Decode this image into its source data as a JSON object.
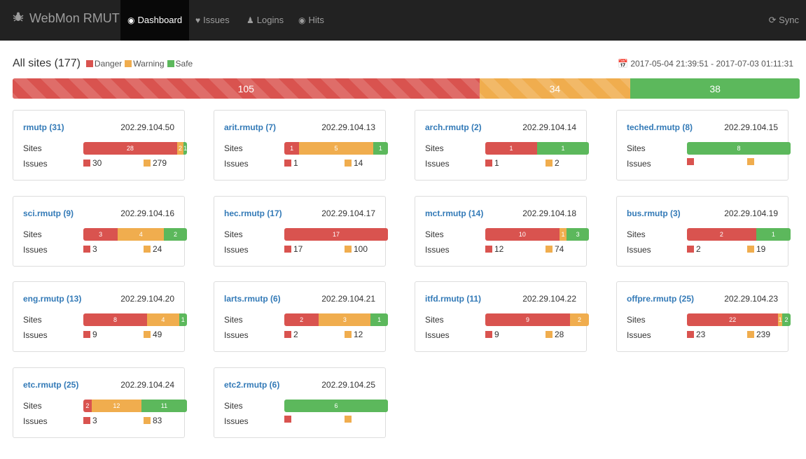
{
  "navbar": {
    "brand": "WebMon RMUTP",
    "items": [
      {
        "label": "Dashboard",
        "icon": "dashboard-icon",
        "active": true
      },
      {
        "label": "Issues",
        "icon": "heartbeat-icon",
        "active": false
      },
      {
        "label": "Logins",
        "icon": "user-icon",
        "active": false
      },
      {
        "label": "Hits",
        "icon": "eye-icon",
        "active": false
      }
    ],
    "sync_label": "Sync"
  },
  "summary": {
    "title": "All sites (177)",
    "legend": {
      "danger": "Danger",
      "warning": "Warning",
      "safe": "Safe"
    },
    "date_range": "2017-05-04 21:39:51 - 2017-07-03 01:11:31",
    "totals": {
      "danger": "105",
      "warning": "34",
      "safe": "38"
    }
  },
  "colors": {
    "danger": "#d9534f",
    "warning": "#f0ad4e",
    "safe": "#5cb85c",
    "link": "#337ab7",
    "navbar": "#222222"
  },
  "labels": {
    "sites": "Sites",
    "issues": "Issues"
  },
  "cards": [
    {
      "name": "rmutp (31)",
      "ip": "202.29.104.50",
      "danger": 28,
      "warning": 2,
      "safe": 1,
      "danger_label": "28",
      "warning_label": "2",
      "safe_label": "1",
      "issues_danger": "30",
      "issues_warning": "279"
    },
    {
      "name": "arit.rmutp (7)",
      "ip": "202.29.104.13",
      "danger": 1,
      "warning": 5,
      "safe": 1,
      "danger_label": "1",
      "warning_label": "5",
      "safe_label": "1",
      "issues_danger": "1",
      "issues_warning": "14"
    },
    {
      "name": "arch.rmutp (2)",
      "ip": "202.29.104.14",
      "danger": 1,
      "warning": 0,
      "safe": 1,
      "danger_label": "1",
      "warning_label": "",
      "safe_label": "1",
      "issues_danger": "1",
      "issues_warning": "2"
    },
    {
      "name": "teched.rmutp (8)",
      "ip": "202.29.104.15",
      "danger": 0,
      "warning": 0,
      "safe": 8,
      "danger_label": "",
      "warning_label": "",
      "safe_label": "8",
      "issues_danger": "",
      "issues_warning": ""
    },
    {
      "name": "sci.rmutp (9)",
      "ip": "202.29.104.16",
      "danger": 3,
      "warning": 4,
      "safe": 2,
      "danger_label": "3",
      "warning_label": "4",
      "safe_label": "2",
      "issues_danger": "3",
      "issues_warning": "24"
    },
    {
      "name": "hec.rmutp (17)",
      "ip": "202.29.104.17",
      "danger": 17,
      "warning": 0,
      "safe": 0,
      "danger_label": "17",
      "warning_label": "",
      "safe_label": "",
      "issues_danger": "17",
      "issues_warning": "100"
    },
    {
      "name": "mct.rmutp (14)",
      "ip": "202.29.104.18",
      "danger": 10,
      "warning": 1,
      "safe": 3,
      "danger_label": "10",
      "warning_label": "1",
      "safe_label": "3",
      "issues_danger": "12",
      "issues_warning": "74"
    },
    {
      "name": "bus.rmutp (3)",
      "ip": "202.29.104.19",
      "danger": 2,
      "warning": 0,
      "safe": 1,
      "danger_label": "2",
      "warning_label": "",
      "safe_label": "1",
      "issues_danger": "2",
      "issues_warning": "19"
    },
    {
      "name": "eng.rmutp (13)",
      "ip": "202.29.104.20",
      "danger": 8,
      "warning": 4,
      "safe": 1,
      "danger_label": "8",
      "warning_label": "4",
      "safe_label": "1",
      "issues_danger": "9",
      "issues_warning": "49"
    },
    {
      "name": "larts.rmutp (6)",
      "ip": "202.29.104.21",
      "danger": 2,
      "warning": 3,
      "safe": 1,
      "danger_label": "2",
      "warning_label": "3",
      "safe_label": "1",
      "issues_danger": "2",
      "issues_warning": "12"
    },
    {
      "name": "itfd.rmutp (11)",
      "ip": "202.29.104.22",
      "danger": 9,
      "warning": 2,
      "safe": 0,
      "danger_label": "9",
      "warning_label": "2",
      "safe_label": "",
      "issues_danger": "9",
      "issues_warning": "28"
    },
    {
      "name": "offpre.rmutp (25)",
      "ip": "202.29.104.23",
      "danger": 22,
      "warning": 1,
      "safe": 2,
      "danger_label": "22",
      "warning_label": "1",
      "safe_label": "2",
      "issues_danger": "23",
      "issues_warning": "239"
    },
    {
      "name": "etc.rmutp (25)",
      "ip": "202.29.104.24",
      "danger": 2,
      "warning": 12,
      "safe": 11,
      "danger_label": "2",
      "warning_label": "12",
      "safe_label": "11",
      "issues_danger": "3",
      "issues_warning": "83"
    },
    {
      "name": "etc2.rmutp (6)",
      "ip": "202.29.104.25",
      "danger": 0,
      "warning": 0,
      "safe": 6,
      "danger_label": "",
      "warning_label": "",
      "safe_label": "6",
      "issues_danger": "",
      "issues_warning": ""
    }
  ]
}
